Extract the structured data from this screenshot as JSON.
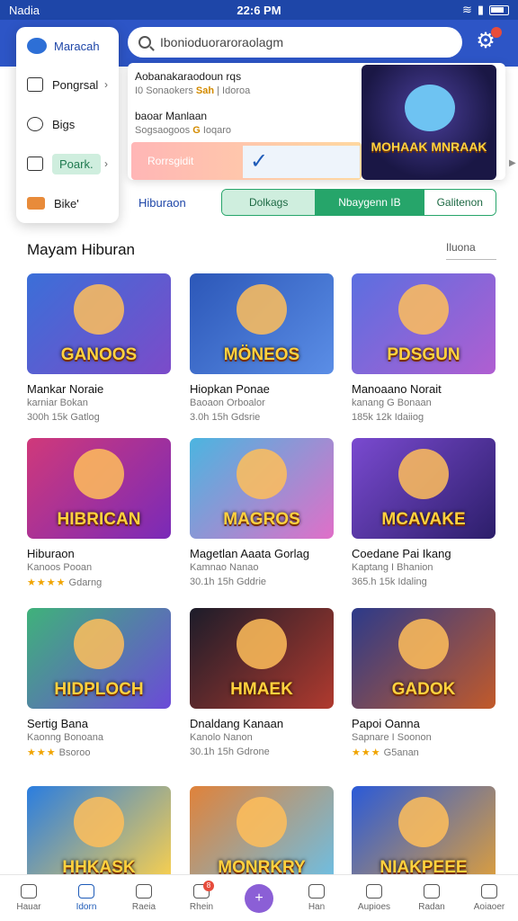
{
  "status_bar": {
    "carrier": "Nadia",
    "time": "22:6 PM"
  },
  "search": {
    "placeholder": "Ibonioduoraroraolagm"
  },
  "drawer": {
    "title": "Maracah",
    "items": [
      {
        "label": "Pongrsal",
        "icon": "image-icon"
      },
      {
        "label": "Bigs",
        "icon": "heart-icon"
      },
      {
        "label": "Poark.",
        "icon": "wallet-icon"
      },
      {
        "label": "Bike'",
        "icon": "basket-icon"
      }
    ]
  },
  "dropdown": {
    "row1_title": "Aobanakaraodoun rqs",
    "row1_sub_prefix": "I0 Sonaokers",
    "row1_sub_highlight": "Sah",
    "row1_sub_suffix": "| Idoroa",
    "row2_title": "baoar Manlaan",
    "row2_sub_prefix": "Sogsaogoos",
    "row2_sub_highlight": "G",
    "row2_sub_suffix": "Ioqaro",
    "action_label": "Rorrsgidit"
  },
  "promo": {
    "title": "MOHAAK MNRAAK"
  },
  "nav_link": "Hiburaon",
  "segments": [
    "Dolkags",
    "Nbaygenn IB",
    "Galitenon"
  ],
  "section": {
    "title": "Mayam Hiburan",
    "see_all": "Iluona"
  },
  "games": [
    {
      "label": "GANOOS",
      "name": "Mankar Noraie",
      "sub": "karniar Bokan",
      "meta": "300h 15k Gatlog",
      "c1": "#3b6fd8",
      "c2": "#7c4bc9"
    },
    {
      "label": "MÖNEOS",
      "name": "Hiopkan Ponae",
      "sub": "Baoaon Orboalor",
      "meta": "3.0h 15h Gdsrie",
      "c1": "#2c57b8",
      "c2": "#5b8ee6"
    },
    {
      "label": "PDSGUN",
      "name": "Manoaano Norait",
      "sub": "kanang G Bonaan",
      "meta": "185k 12k Idaiiog",
      "c1": "#5b6fe0",
      "c2": "#b05ed1"
    },
    {
      "label": "HIBRICAN",
      "name": "Hiburaon",
      "sub": "Kanoos Pooan",
      "meta": "Gdarng",
      "stars": "★★★★",
      "c1": "#d0397a",
      "c2": "#7a2ab8"
    },
    {
      "label": "MAGROS",
      "name": "Magetlan Aaata Gorlag",
      "sub": "Kamnao Nanao",
      "meta": "30.1h 15h Gddrie",
      "c1": "#4bb5e0",
      "c2": "#e06fc8"
    },
    {
      "label": "MCAVAKE",
      "name": "Coedane Pai Ikang",
      "sub": "Kaptang I Bhanion",
      "meta": "365.h 15k Idaling",
      "c1": "#7a4ad0",
      "c2": "#2c1e6a"
    },
    {
      "label": "HIDPLOCH",
      "name": "Sertig Bana",
      "sub": "Kaonng Bonoana",
      "meta": "Bsoroo",
      "stars": "★★★",
      "c1": "#3fb27a",
      "c2": "#6b4ad8"
    },
    {
      "label": "HMAEK",
      "name": "Dnaldang Kanaan",
      "sub": "Kanolo Nanon",
      "meta": "30.1h 15h Gdrone",
      "c1": "#1c1c2a",
      "c2": "#b03a2e"
    },
    {
      "label": "GADOK",
      "name": "Papoi Oanna",
      "sub": "Sapnare I Soonon",
      "meta": "G5anan",
      "stars": "★★★",
      "c1": "#2c3a8a",
      "c2": "#c25a2a"
    },
    {
      "label": "HHKASK",
      "name": "",
      "sub": "",
      "meta": "",
      "c1": "#2a7de0",
      "c2": "#ffd24a"
    },
    {
      "label": "MONRKRY",
      "name": "",
      "sub": "",
      "meta": "",
      "c1": "#e0823a",
      "c2": "#6ac0e8"
    },
    {
      "label": "NIAKPEEE",
      "name": "",
      "sub": "",
      "meta": "",
      "c1": "#2a5ad8",
      "c2": "#e0a03a"
    }
  ],
  "bottom_nav": [
    {
      "label": "Hauar",
      "icon": "home-icon"
    },
    {
      "label": "Idorn",
      "icon": "explore-icon",
      "active": true
    },
    {
      "label": "Raeia",
      "icon": "search-icon"
    },
    {
      "label": "Rhein",
      "icon": "chat-icon",
      "badge": "8"
    },
    {
      "label": "",
      "icon": "plus-icon",
      "fab": true
    },
    {
      "label": "Han",
      "icon": "game-icon"
    },
    {
      "label": "Aupioes",
      "icon": "gift-icon"
    },
    {
      "label": "Radan",
      "icon": "trophy-icon"
    },
    {
      "label": "Aoiaoer",
      "icon": "profile-icon"
    }
  ]
}
